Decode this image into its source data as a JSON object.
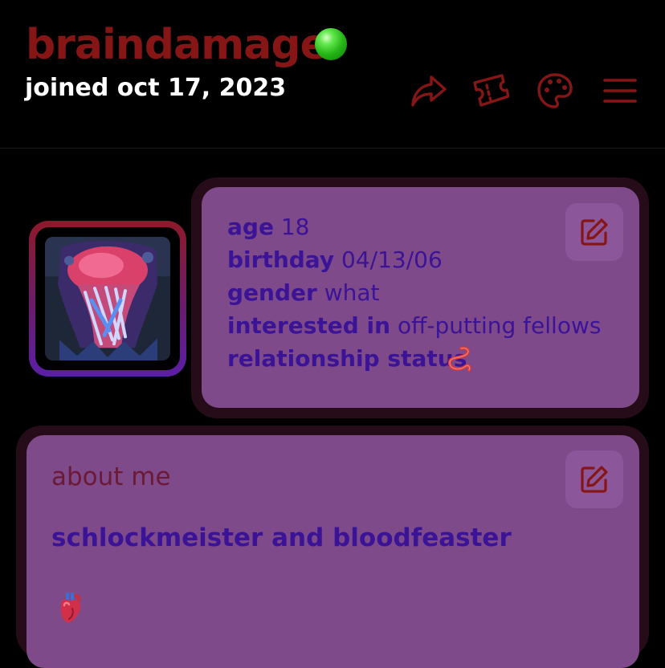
{
  "profile": {
    "username": "braindamage",
    "joined": "joined oct 17, 2023",
    "online_status_color": "#2fcc1c"
  },
  "header_actions": [
    {
      "icon": "share-icon"
    },
    {
      "icon": "ticket-icon"
    },
    {
      "icon": "palette-icon"
    },
    {
      "icon": "menu-icon"
    }
  ],
  "details": {
    "age_label": "age",
    "age_value": "18",
    "birthday_label": "birthday",
    "birthday_value": "04/13/06",
    "gender_label": "gender",
    "gender_value": "what",
    "interested_label": "interested in",
    "interested_value": "off-putting fellows",
    "relationship_label": "relationship status",
    "relationship_value_icon": "worm-emoji-icon"
  },
  "about": {
    "title": "about me",
    "text": "schlockmeister and bloodfeaster",
    "emoji_icon": "anatomical-heart-icon"
  },
  "colors": {
    "accent_red": "#861616",
    "card_purple": "#7f4a8a",
    "text_indigo": "#3a1397",
    "background": "#000000"
  }
}
